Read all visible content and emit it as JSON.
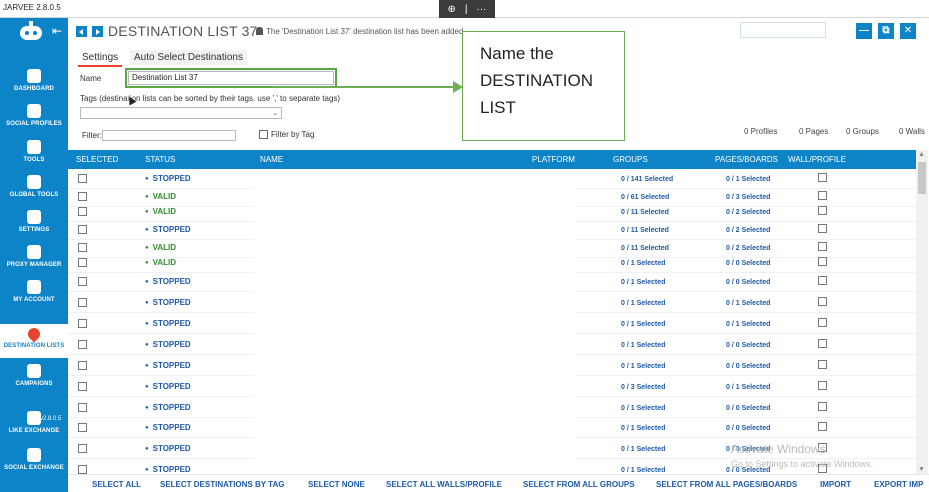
{
  "app": {
    "title": "JARVEE 2.8.0.5",
    "version": "v2.8.0.5"
  },
  "zoom": {
    "zoom_icon": "⊕",
    "sep": "|",
    "more": "···"
  },
  "sidebar": {
    "items": [
      {
        "label": "DASHBOARD",
        "icon": "palette-icon"
      },
      {
        "label": "SOCIAL PROFILES",
        "icon": "profiles-icon"
      },
      {
        "label": "TOOLS",
        "icon": "tools-icon"
      },
      {
        "label": "GLOBAL TOOLS",
        "icon": "global-tools-icon"
      },
      {
        "label": "SETTINGS",
        "icon": "settings-icon"
      },
      {
        "label": "PROXY MANAGER",
        "icon": "proxy-icon"
      },
      {
        "label": "MY ACCOUNT",
        "icon": "user-icon"
      },
      {
        "label": "DESTINATION LISTS",
        "icon": "map-pin-icon"
      },
      {
        "label": "CAMPAIGNS",
        "icon": "calendar-icon"
      },
      {
        "label": "LIKE EXCHANGE",
        "icon": "like-exchange-icon"
      },
      {
        "label": "SOCIAL EXCHANGE",
        "icon": "social-exchange-icon"
      }
    ]
  },
  "header": {
    "title": "DESTINATION LIST 37",
    "notice": "The 'Destination List 37' destination list has been added.",
    "min": "—",
    "max": "⧉",
    "close": "✕"
  },
  "tabs": {
    "settings": "Settings",
    "auto": "Auto Select Destinations"
  },
  "form": {
    "name_label": "Name",
    "name_value": "Destination List 37",
    "tags_label": "Tags (destination lists can be sorted by their tags. use ',' to separate tags)",
    "filter_label": "Filter:",
    "filter_by_tag": "Filter by Tag"
  },
  "stats": {
    "profiles": "0 Profiles",
    "pages": "0 Pages",
    "groups": "0 Groups",
    "walls": "0 Walls"
  },
  "callout": {
    "line1": "Name the",
    "line2": "DESTINATION",
    "line3": "LIST"
  },
  "table": {
    "columns": {
      "selected": "SELECTED",
      "status": "STATUS",
      "name": "NAME",
      "platform": "PLATFORM",
      "groups": "GROUPS",
      "pages": "PAGES/BOARDS",
      "wall": "WALL/PROFILE"
    },
    "rows": [
      {
        "status": "STOPPED",
        "groups": "0 / 141 Selected",
        "pages": "0 / 1 Selected"
      },
      {
        "status": "VALID",
        "groups": "0 / 61 Selected",
        "pages": "0 / 3 Selected"
      },
      {
        "status": "VALID",
        "groups": "0 / 11 Selected",
        "pages": "0 / 2 Selected"
      },
      {
        "status": "STOPPED",
        "groups": "0 / 11 Selected",
        "pages": "0 / 2 Selected"
      },
      {
        "status": "VALID",
        "groups": "0 / 11 Selected",
        "pages": "0 / 2 Selected"
      },
      {
        "status": "VALID",
        "groups": "0 / 1 Selected",
        "pages": "0 / 0 Selected"
      },
      {
        "status": "STOPPED",
        "groups": "0 / 1 Selected",
        "pages": "0 / 0 Selected"
      },
      {
        "status": "STOPPED",
        "groups": "0 / 1 Selected",
        "pages": "0 / 1 Selected"
      },
      {
        "status": "STOPPED",
        "groups": "0 / 1 Selected",
        "pages": "0 / 1 Selected"
      },
      {
        "status": "STOPPED",
        "groups": "0 / 1 Selected",
        "pages": "0 / 0 Selected"
      },
      {
        "status": "STOPPED",
        "groups": "0 / 1 Selected",
        "pages": "0 / 0 Selected"
      },
      {
        "status": "STOPPED",
        "groups": "0 / 3 Selected",
        "pages": "0 / 1 Selected"
      },
      {
        "status": "STOPPED",
        "groups": "0 / 1 Selected",
        "pages": "0 / 0 Selected"
      },
      {
        "status": "STOPPED",
        "groups": "0 / 1 Selected",
        "pages": "0 / 0 Selected"
      },
      {
        "status": "STOPPED",
        "groups": "0 / 1 Selected",
        "pages": "0 / 0 Selected"
      },
      {
        "status": "STOPPED",
        "groups": "0 / 1 Selected",
        "pages": "0 / 0 Selected"
      }
    ]
  },
  "watermark": {
    "line1": "Activate Windows",
    "line2": "Go to Settings to activate Windows."
  },
  "bottom": {
    "select_all": "SELECT ALL",
    "select_by_tag": "SELECT DESTINATIONS BY TAG",
    "select_none": "SELECT NONE",
    "select_walls": "SELECT ALL WALLS/PROFILE",
    "select_groups": "SELECT FROM ALL GROUPS",
    "select_pages": "SELECT FROM ALL PAGES/BOARDS",
    "import": "IMPORT",
    "export": "EXPORT IMP"
  }
}
